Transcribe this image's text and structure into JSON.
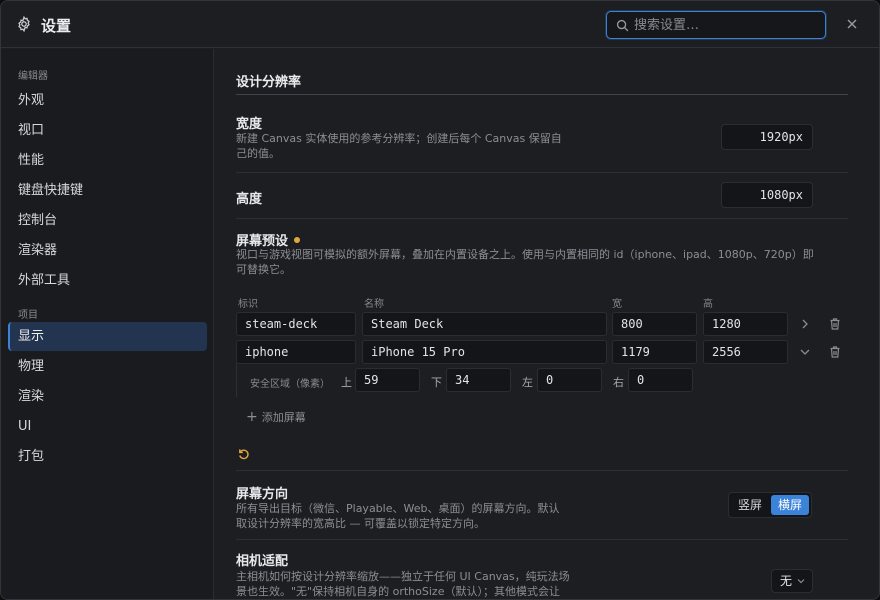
{
  "titlebar": {
    "title": "设置",
    "search_placeholder": "搜索设置…",
    "icons": [
      "gear-icon",
      "search-icon",
      "close-icon"
    ]
  },
  "sidebar": {
    "groups": [
      {
        "label": "编辑器",
        "items": [
          "外观",
          "视口",
          "性能",
          "键盘快捷键",
          "控制台",
          "渲染器",
          "外部工具"
        ]
      },
      {
        "label": "项目",
        "items": [
          "显示",
          "物理",
          "渲染",
          "UI",
          "打包"
        ]
      }
    ],
    "active": "显示"
  },
  "main": {
    "section_title": "设计分辨率",
    "width": {
      "label": "宽度",
      "desc_1": "新建 Canvas 实体使用的参考分辨率；创建后每个 Canvas 保留自",
      "desc_2": "己的值。",
      "value": "1920px"
    },
    "height": {
      "label": "高度",
      "value": "1080px"
    },
    "presets": {
      "label": "屏幕预设",
      "modified_indicator_color": "#e0a93a",
      "desc_1": "视口与游戏视图可模拟的额外屏幕，叠加在内置设备之上。使用与内置相同的 id（iphone、ipad、1080p、720p）即",
      "desc_2": "可替换它。",
      "columns": [
        "标识",
        "名称",
        "宽",
        "高"
      ],
      "rows": [
        {
          "id": "steam-deck",
          "name": "Steam Deck",
          "w": "800",
          "h": "1280"
        },
        {
          "id": "iphone",
          "name": "iPhone 15 Pro",
          "w": "1179",
          "h": "2556"
        }
      ],
      "safe_area": {
        "label": "安全区域（像素）",
        "top_label": "上",
        "top": "59",
        "bottom_label": "下",
        "bottom": "34",
        "left_label": "左",
        "left": "0",
        "right_label": "右",
        "right": "0"
      },
      "add_label": "添加屏幕"
    },
    "orientation": {
      "label": "屏幕方向",
      "desc_1": "所有导出目标（微信、Playable、Web、桌面）的屏幕方向。默认",
      "desc_2": "取设计分辨率的宽高比 — 可覆盖以锁定特定方向。",
      "options": [
        "竖屏",
        "横屏"
      ],
      "selected": "横屏",
      "accent": "#3b82d9"
    },
    "camera_fit": {
      "label": "相机适配",
      "desc_1": "主相机如何按设计分辨率缩放——独立于任何 UI Canvas，纯玩法场",
      "desc_2": "景也生效。\"无\"保持相机自身的 orthoSize（默认）；其他模式会让",
      "value": "无"
    }
  }
}
